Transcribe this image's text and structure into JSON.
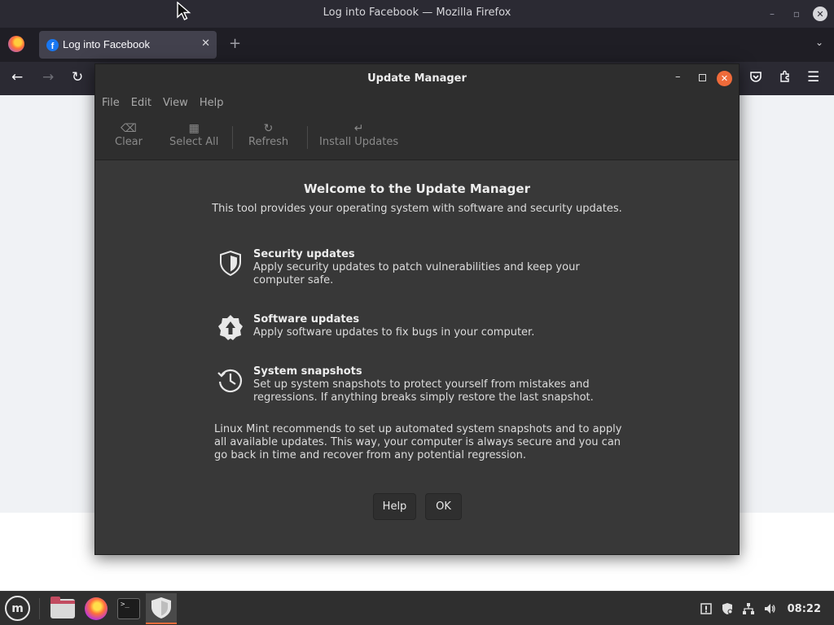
{
  "firefox": {
    "window_title": "Log into Facebook — Mozilla Firefox",
    "tab": {
      "label": "Log into Facebook",
      "close": "✕",
      "favicon": "f"
    },
    "new_tab": "+",
    "tab_list": "⌄",
    "win_buttons": {
      "minimize": "–",
      "restore": "▫",
      "close": "✕"
    },
    "nav": {
      "back": "←",
      "forward": "→",
      "reload": "↻",
      "pocket": "pocket-icon",
      "extensions": "puzzle-icon",
      "menu": "☰"
    }
  },
  "update_manager": {
    "title": "Update Manager",
    "controls": {
      "minimize": "–",
      "close": "✕"
    },
    "menu": [
      "File",
      "Edit",
      "View",
      "Help"
    ],
    "toolbar": {
      "clear": {
        "label": "Clear",
        "icon": "⌫"
      },
      "select_all": {
        "label": "Select All",
        "icon": "▦"
      },
      "refresh": {
        "label": "Refresh",
        "icon": "↻"
      },
      "install": {
        "label": "Install Updates",
        "icon": "↵"
      }
    },
    "welcome_title": "Welcome to the Update Manager",
    "welcome_subtitle": "This tool provides your operating system with software and security updates.",
    "features": [
      {
        "icon": "shield-icon",
        "title": "Security updates",
        "description": "Apply security updates to patch vulnerabilities and keep your computer safe."
      },
      {
        "icon": "upgrade-arrow-icon",
        "title": "Software updates",
        "description": "Apply software updates to fix bugs in your computer."
      },
      {
        "icon": "history-clock-icon",
        "title": "System snapshots",
        "description": "Set up system snapshots to protect yourself from mistakes and regressions. If anything breaks simply restore the last snapshot."
      }
    ],
    "recommendation": "Linux Mint recommends to set up automated system snapshots and to apply all available updates. This way, your computer is always secure and you can go back in time and recover from any potential regression.",
    "buttons": {
      "help": "Help",
      "ok": "OK"
    }
  },
  "panel": {
    "menu_label": "m",
    "terminal_prompt": ">_",
    "tray": {
      "update": "!",
      "network": "⊞",
      "volume": "🔊"
    },
    "clock": "08:22"
  },
  "colors": {
    "accent": "#ef6b3a",
    "dialog_bg": "#383838",
    "header_bg": "#2e2e2e",
    "firefox_bg": "#2b2a33"
  }
}
